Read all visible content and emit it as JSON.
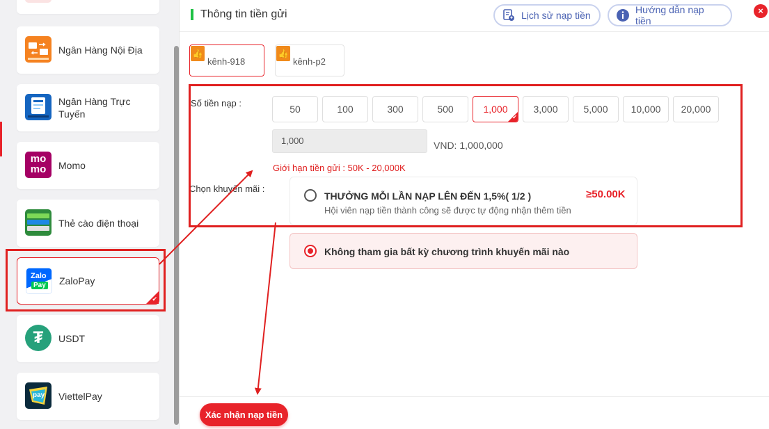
{
  "sidebar": {
    "items": [
      {
        "label": "Ngân Hàng Nội Địa",
        "icon": "bank-transfer-icon"
      },
      {
        "label": "Ngân Hàng Trực Tuyến",
        "icon": "online-banking-icon"
      },
      {
        "label": "Momo",
        "icon": "momo-icon",
        "icon_text_1": "mo",
        "icon_text_2": "mo"
      },
      {
        "label": "Thẻ cào điện thoại",
        "icon": "phone-card-icon"
      },
      {
        "label": "ZaloPay",
        "icon": "zalopay-icon",
        "icon_text_1": "Zalo",
        "icon_text_2": "Pay",
        "selected": true
      },
      {
        "label": "USDT",
        "icon": "usdt-icon",
        "icon_text": "₮"
      },
      {
        "label": "ViettelPay",
        "icon": "viettelpay-icon",
        "icon_text": "pay"
      }
    ]
  },
  "header": {
    "title": "Thông tin tiền gửi",
    "history_label": "Lịch sử nạp tiền",
    "guide_label": "Hướng dẫn nạp tiền",
    "close_symbol": "×"
  },
  "channels": [
    {
      "label": "kênh-918",
      "active": true
    },
    {
      "label": "kênh-p2",
      "active": false
    }
  ],
  "amount": {
    "label": "Số tiền nạp :",
    "options": [
      "50",
      "100",
      "300",
      "500",
      "1,000",
      "3,000",
      "5,000",
      "10,000",
      "20,000"
    ],
    "selected": "1,000",
    "input_value": "1,000",
    "vnd_text": "VND: 1,000,000",
    "limit_text": "Giới hạn tiền gửi :  50K  - 20,000K"
  },
  "promotion": {
    "label": "Chọn khuyến mãi :",
    "option_title": "THƯỞNG MỖI LẦN NẠP LÊN ĐẾN 1,5%( 1/2 )",
    "option_desc": "Hội viên nạp tiền thành công sẽ được tự động nhận thêm tiền",
    "option_badge": "≥50.00K",
    "none_label": "Không tham gia bất kỳ chương trình khuyến mãi nào",
    "none_selected": true
  },
  "footer": {
    "confirm_label": "Xác nhận nạp tiền"
  },
  "colors": {
    "accent": "#e8232a",
    "green_bar": "#1fc145",
    "pill_text": "#4a62b3",
    "annotation": "#e02020"
  }
}
